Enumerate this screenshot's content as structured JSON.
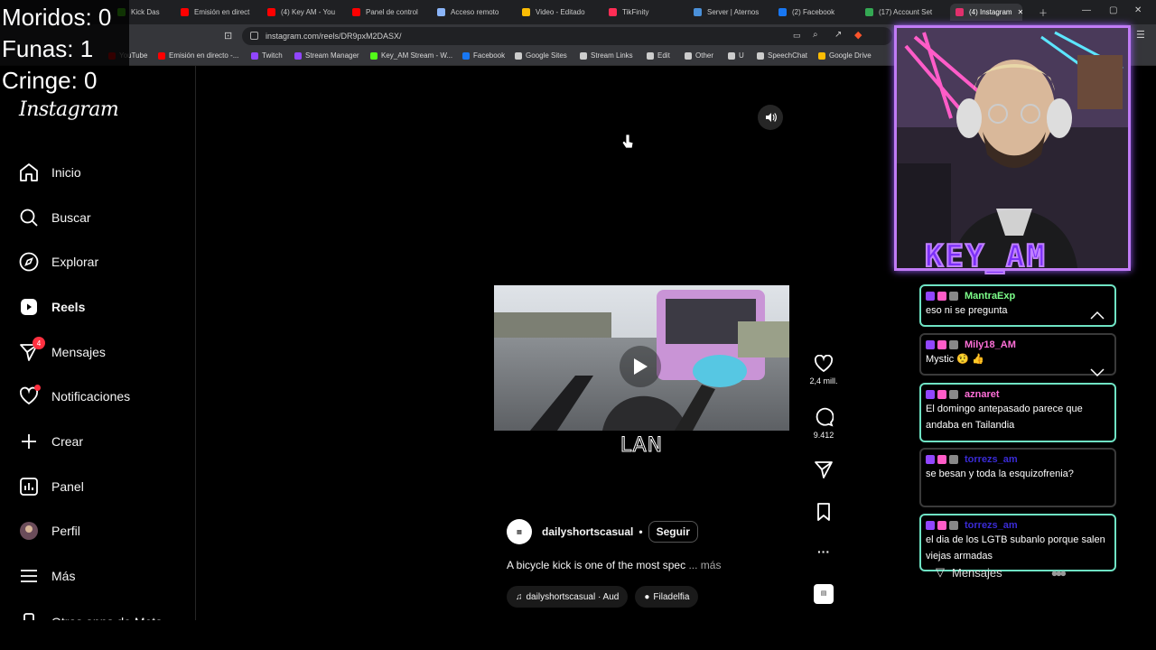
{
  "overlay": {
    "counters": [
      "Moridos: 0",
      "Funas: 1",
      "Cringe: 0"
    ],
    "brand": "KEY_AM"
  },
  "browser": {
    "tabs": [
      {
        "label": "Kick Das",
        "color": "#53fc18"
      },
      {
        "label": "Emisión en direct",
        "color": "#ff0000"
      },
      {
        "label": "(4) Key AM - You",
        "color": "#ff0000"
      },
      {
        "label": "Panel de control",
        "color": "#ff0000"
      },
      {
        "label": "Acceso remoto",
        "color": "#8ab4f8"
      },
      {
        "label": "Video - Editado",
        "color": "#fbbc04"
      },
      {
        "label": "TikFinity",
        "color": "#ff2d55"
      },
      {
        "label": "Server | Aternos",
        "color": "#4a90d9"
      },
      {
        "label": "(2) Facebook",
        "color": "#1877f2"
      },
      {
        "label": "(17) Account Set",
        "color": "#34a853"
      },
      {
        "label": "(4) Instagram",
        "color": "#e1306c"
      }
    ],
    "url": "instagram.com/reels/DR9pxM2DASX/",
    "bookmarks": [
      {
        "label": "YouTube",
        "color": "#ff0000"
      },
      {
        "label": "Emisión en directo -...",
        "color": "#ff0000"
      },
      {
        "label": "Twitch",
        "color": "#9146ff"
      },
      {
        "label": "Stream Manager",
        "color": "#9146ff"
      },
      {
        "label": "Key_AM Stream - W...",
        "color": "#53fc18"
      },
      {
        "label": "Facebook",
        "color": "#1877f2"
      },
      {
        "label": "Google Sites",
        "color": "#cccccc"
      },
      {
        "label": "Stream Links",
        "color": "#cccccc"
      },
      {
        "label": "Edit",
        "color": "#cccccc"
      },
      {
        "label": "Other",
        "color": "#cccccc"
      },
      {
        "label": "U",
        "color": "#cccccc"
      },
      {
        "label": "SpeechChat",
        "color": "#cccccc"
      },
      {
        "label": "Google Drive",
        "color": "#fbbc04"
      }
    ]
  },
  "instagram": {
    "logo": "Instagram",
    "nav": [
      {
        "label": "Inicio",
        "icon": "home-icon"
      },
      {
        "label": "Buscar",
        "icon": "search-icon"
      },
      {
        "label": "Explorar",
        "icon": "compass-icon"
      },
      {
        "label": "Reels",
        "icon": "reels-icon"
      },
      {
        "label": "Mensajes",
        "icon": "messenger-icon",
        "badge": "4"
      },
      {
        "label": "Notificaciones",
        "icon": "heart-icon"
      },
      {
        "label": "Crear",
        "icon": "plus-icon"
      },
      {
        "label": "Panel",
        "icon": "chart-icon"
      },
      {
        "label": "Perfil",
        "icon": "avatar-icon"
      },
      {
        "label": "Más",
        "icon": "menu-icon"
      },
      {
        "label": "Otras apps de Meta",
        "icon": "meta-icon"
      }
    ],
    "reel": {
      "overlay_text": "LAN",
      "author": "dailyshortscasual",
      "separator": "•",
      "follow_label": "Seguir",
      "caption": "A bicycle kick is one of the most spec",
      "more_label": "... más",
      "audio": "dailyshortscasual · Aud",
      "location": "Filadelfia",
      "likes": "2,4 mill.",
      "comments": "9.412"
    }
  },
  "chat": {
    "messages": [
      {
        "user": "MantraExp",
        "color": "#7dff8a",
        "text": "eso ni se pregunta",
        "border": "#6fe3c4"
      },
      {
        "user": "Mily18_AM",
        "color": "#ff6fd8",
        "text": "Mystic 🤨 👍",
        "border": "#3a3a3a"
      },
      {
        "user": "aznaret",
        "color": "#ff6fd8",
        "text": "El domingo antepasado parece que andaba en Tailandia",
        "border": "#6fe3c4"
      },
      {
        "user": "torrezs_am",
        "color": "#3a2bd6",
        "text": "se besan y toda la esquizofrenia?",
        "border": "#3a3a3a"
      },
      {
        "user": "torrezs_am",
        "color": "#3a2bd6",
        "text": "el dia de los LGTB subanlo porque salen viejas armadas",
        "border": "#6fe3c4"
      }
    ],
    "footer_label": "Mensajes"
  }
}
